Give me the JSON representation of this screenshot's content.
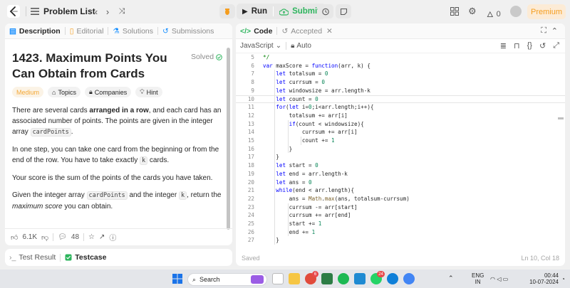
{
  "topbar": {
    "problem_list": "Problem List",
    "run": "Run",
    "submit": "Submit",
    "streak": "0",
    "premium": "Premium"
  },
  "left": {
    "tabs": [
      "Description",
      "Editorial",
      "Solutions",
      "Submissions"
    ],
    "title": "1423. Maximum Points You Can Obtain from Cards",
    "solved": "Solved",
    "tags": [
      "Medium",
      "Topics",
      "Companies",
      "Hint"
    ],
    "desc": {
      "p1a": "There are several cards ",
      "p1b": "arranged in a row",
      "p1c": ", and each card has an associated number of points. The points are given in the integer array ",
      "p1code": "cardPoints",
      "p1d": ".",
      "p2a": "In one step, you can take one card from the beginning or from the end of the row. You have to take exactly ",
      "p2code": "k",
      "p2b": " cards.",
      "p3": "Your score is the sum of the points of the cards you have taken.",
      "p4a": "Given the integer array ",
      "p4code1": "cardPoints",
      "p4b": " and the integer ",
      "p4code2": "k",
      "p4c": ", return the ",
      "p4em": "maximum score",
      "p4d": " you can obtain."
    },
    "likes": "6.1K",
    "comments": "48"
  },
  "testbar": {
    "test_result": "Test Result",
    "testcase": "Testcase"
  },
  "editor": {
    "tab_code": "Code",
    "tab_accepted": "Accepted",
    "language": "JavaScript",
    "auto": "Auto",
    "saved": "Saved",
    "cursor": "Ln 10, Col 18",
    "lines": [
      {
        "n": "5",
        "t": "*/"
      },
      {
        "n": "6",
        "t": "var maxScore = function(arr, k) {"
      },
      {
        "n": "7",
        "t": "    let totalsum = 0"
      },
      {
        "n": "8",
        "t": "    let currsum = 0"
      },
      {
        "n": "9",
        "t": "    let windowsize = arr.length-k"
      },
      {
        "n": "10",
        "t": "    let count = 0"
      },
      {
        "n": "11",
        "t": "    for(let i=0;i<arr.length;i++){"
      },
      {
        "n": "12",
        "t": "        totalsum += arr[i]"
      },
      {
        "n": "13",
        "t": "        if(count < windowsize){"
      },
      {
        "n": "14",
        "t": "            currsum += arr[i]"
      },
      {
        "n": "15",
        "t": "            count += 1"
      },
      {
        "n": "16",
        "t": "        }"
      },
      {
        "n": "17",
        "t": "    }"
      },
      {
        "n": "18",
        "t": "    let start = 0"
      },
      {
        "n": "19",
        "t": "    let end = arr.length-k"
      },
      {
        "n": "20",
        "t": "    let ans = 0"
      },
      {
        "n": "21",
        "t": "    while(end < arr.length){"
      },
      {
        "n": "22",
        "t": "        ans = Math.max(ans, totalsum-currsum)"
      },
      {
        "n": "23",
        "t": "        currsum -= arr[start]"
      },
      {
        "n": "24",
        "t": "        currsum += arr[end]"
      },
      {
        "n": "25",
        "t": "        start += 1"
      },
      {
        "n": "26",
        "t": "        end += 1"
      },
      {
        "n": "27",
        "t": "    }"
      }
    ]
  },
  "taskbar": {
    "search": "Search",
    "lang1": "ENG",
    "lang2": "IN",
    "time": "00:44",
    "date": "10-07-2024",
    "badge1": "6",
    "badge2": "24"
  },
  "colors": {
    "accent": "#ffa116",
    "submit": "#2db55d",
    "keyword": "#0000ff"
  }
}
